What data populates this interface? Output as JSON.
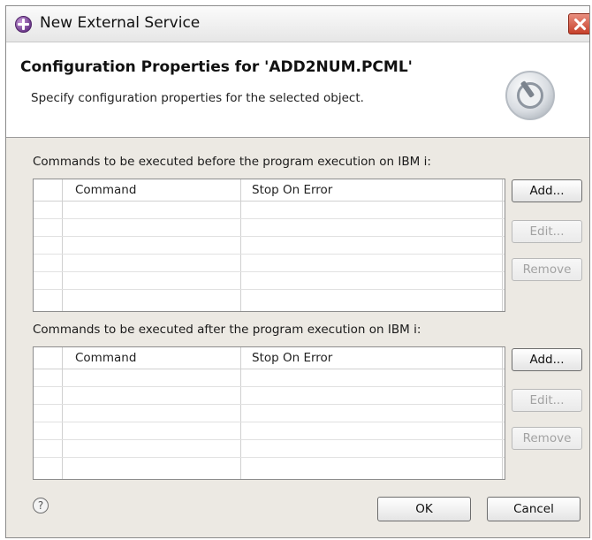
{
  "window": {
    "title": "New External Service"
  },
  "header": {
    "title": "Configuration Properties for 'ADD2NUM.PCML'",
    "description": "Specify configuration properties for the selected object."
  },
  "before_section": {
    "label": "Commands to be executed before the program execution on IBM i:",
    "columns": [
      "Command",
      "Stop On Error"
    ],
    "rows": [],
    "buttons": {
      "add": "Add...",
      "edit": "Edit...",
      "remove": "Remove"
    }
  },
  "after_section": {
    "label": "Commands to be executed after the program execution on IBM i:",
    "columns": [
      "Command",
      "Stop On Error"
    ],
    "rows": [],
    "buttons": {
      "add": "Add...",
      "edit": "Edit...",
      "remove": "Remove"
    }
  },
  "footer": {
    "help_glyph": "?",
    "ok": "OK",
    "cancel": "Cancel"
  },
  "colors": {
    "dialog_bg": "#ece9e3",
    "close_button": "#c6402a",
    "app_icon": "#6d3a8c"
  },
  "icons": {
    "app": "eclipse-plus-icon",
    "close": "close-icon",
    "banner": "dial-wizard-icon",
    "help": "help-icon"
  }
}
